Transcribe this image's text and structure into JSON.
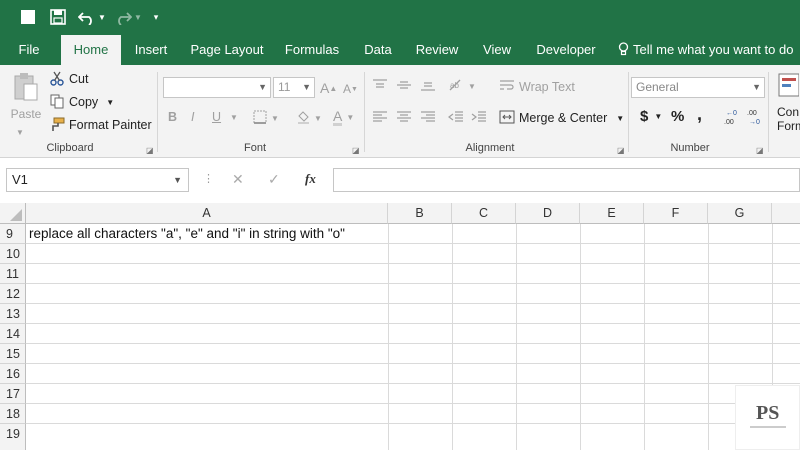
{
  "qat": {
    "undo_icon": "undo-icon",
    "redo_icon": "redo-icon"
  },
  "tabs": [
    {
      "label": "File"
    },
    {
      "label": "Home"
    },
    {
      "label": "Insert"
    },
    {
      "label": "Page Layout"
    },
    {
      "label": "Formulas"
    },
    {
      "label": "Data"
    },
    {
      "label": "Review"
    },
    {
      "label": "View"
    },
    {
      "label": "Developer"
    },
    {
      "label": "Tell me what you want to do"
    }
  ],
  "clipboard": {
    "paste": "Paste",
    "cut": "Cut",
    "copy": "Copy",
    "format_painter": "Format Painter",
    "group": "Clipboard"
  },
  "font": {
    "size": "11",
    "bold": "B",
    "italic": "I",
    "underline": "U",
    "grow": "A",
    "shrink": "A",
    "font_color": "A",
    "group": "Font"
  },
  "alignment": {
    "wrap_text": "Wrap Text",
    "merge_center": "Merge & Center",
    "group": "Alignment"
  },
  "number": {
    "format": "General",
    "currency": "$",
    "percent": "%",
    "comma": ",",
    "group": "Number"
  },
  "styles": {
    "conditional_1": "Con",
    "conditional_2": "Form"
  },
  "formula_bar": {
    "name_box": "V1",
    "cancel": "✕",
    "enter": "✓",
    "fx": "fx",
    "value": ""
  },
  "sheet": {
    "columns": [
      "A",
      "B",
      "C",
      "D",
      "E",
      "F",
      "G"
    ],
    "rows": [
      "9",
      "10",
      "11",
      "12",
      "13",
      "14",
      "15",
      "16",
      "17",
      "18",
      "19"
    ],
    "cell_a9": "replace all characters \"a\", \"e\" and \"i\" in string with \"o\""
  },
  "watermark": {
    "logo": "PS"
  }
}
